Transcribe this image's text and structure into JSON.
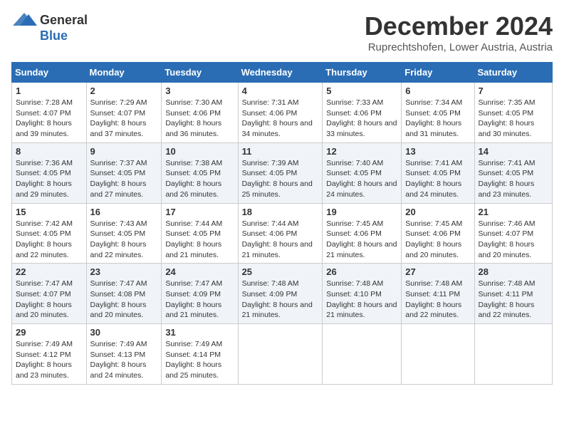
{
  "logo": {
    "general_text": "General",
    "blue_text": "Blue"
  },
  "header": {
    "month_year": "December 2024",
    "location": "Ruprechtshofen, Lower Austria, Austria"
  },
  "weekdays": [
    "Sunday",
    "Monday",
    "Tuesday",
    "Wednesday",
    "Thursday",
    "Friday",
    "Saturday"
  ],
  "weeks": [
    [
      {
        "day": "1",
        "sunrise": "7:28 AM",
        "sunset": "4:07 PM",
        "daylight": "8 hours and 39 minutes."
      },
      {
        "day": "2",
        "sunrise": "7:29 AM",
        "sunset": "4:07 PM",
        "daylight": "8 hours and 37 minutes."
      },
      {
        "day": "3",
        "sunrise": "7:30 AM",
        "sunset": "4:06 PM",
        "daylight": "8 hours and 36 minutes."
      },
      {
        "day": "4",
        "sunrise": "7:31 AM",
        "sunset": "4:06 PM",
        "daylight": "8 hours and 34 minutes."
      },
      {
        "day": "5",
        "sunrise": "7:33 AM",
        "sunset": "4:06 PM",
        "daylight": "8 hours and 33 minutes."
      },
      {
        "day": "6",
        "sunrise": "7:34 AM",
        "sunset": "4:05 PM",
        "daylight": "8 hours and 31 minutes."
      },
      {
        "day": "7",
        "sunrise": "7:35 AM",
        "sunset": "4:05 PM",
        "daylight": "8 hours and 30 minutes."
      }
    ],
    [
      {
        "day": "8",
        "sunrise": "7:36 AM",
        "sunset": "4:05 PM",
        "daylight": "8 hours and 29 minutes."
      },
      {
        "day": "9",
        "sunrise": "7:37 AM",
        "sunset": "4:05 PM",
        "daylight": "8 hours and 27 minutes."
      },
      {
        "day": "10",
        "sunrise": "7:38 AM",
        "sunset": "4:05 PM",
        "daylight": "8 hours and 26 minutes."
      },
      {
        "day": "11",
        "sunrise": "7:39 AM",
        "sunset": "4:05 PM",
        "daylight": "8 hours and 25 minutes."
      },
      {
        "day": "12",
        "sunrise": "7:40 AM",
        "sunset": "4:05 PM",
        "daylight": "8 hours and 24 minutes."
      },
      {
        "day": "13",
        "sunrise": "7:41 AM",
        "sunset": "4:05 PM",
        "daylight": "8 hours and 24 minutes."
      },
      {
        "day": "14",
        "sunrise": "7:41 AM",
        "sunset": "4:05 PM",
        "daylight": "8 hours and 23 minutes."
      }
    ],
    [
      {
        "day": "15",
        "sunrise": "7:42 AM",
        "sunset": "4:05 PM",
        "daylight": "8 hours and 22 minutes."
      },
      {
        "day": "16",
        "sunrise": "7:43 AM",
        "sunset": "4:05 PM",
        "daylight": "8 hours and 22 minutes."
      },
      {
        "day": "17",
        "sunrise": "7:44 AM",
        "sunset": "4:05 PM",
        "daylight": "8 hours and 21 minutes."
      },
      {
        "day": "18",
        "sunrise": "7:44 AM",
        "sunset": "4:06 PM",
        "daylight": "8 hours and 21 minutes."
      },
      {
        "day": "19",
        "sunrise": "7:45 AM",
        "sunset": "4:06 PM",
        "daylight": "8 hours and 21 minutes."
      },
      {
        "day": "20",
        "sunrise": "7:45 AM",
        "sunset": "4:06 PM",
        "daylight": "8 hours and 20 minutes."
      },
      {
        "day": "21",
        "sunrise": "7:46 AM",
        "sunset": "4:07 PM",
        "daylight": "8 hours and 20 minutes."
      }
    ],
    [
      {
        "day": "22",
        "sunrise": "7:47 AM",
        "sunset": "4:07 PM",
        "daylight": "8 hours and 20 minutes."
      },
      {
        "day": "23",
        "sunrise": "7:47 AM",
        "sunset": "4:08 PM",
        "daylight": "8 hours and 20 minutes."
      },
      {
        "day": "24",
        "sunrise": "7:47 AM",
        "sunset": "4:09 PM",
        "daylight": "8 hours and 21 minutes."
      },
      {
        "day": "25",
        "sunrise": "7:48 AM",
        "sunset": "4:09 PM",
        "daylight": "8 hours and 21 minutes."
      },
      {
        "day": "26",
        "sunrise": "7:48 AM",
        "sunset": "4:10 PM",
        "daylight": "8 hours and 21 minutes."
      },
      {
        "day": "27",
        "sunrise": "7:48 AM",
        "sunset": "4:11 PM",
        "daylight": "8 hours and 22 minutes."
      },
      {
        "day": "28",
        "sunrise": "7:48 AM",
        "sunset": "4:11 PM",
        "daylight": "8 hours and 22 minutes."
      }
    ],
    [
      {
        "day": "29",
        "sunrise": "7:49 AM",
        "sunset": "4:12 PM",
        "daylight": "8 hours and 23 minutes."
      },
      {
        "day": "30",
        "sunrise": "7:49 AM",
        "sunset": "4:13 PM",
        "daylight": "8 hours and 24 minutes."
      },
      {
        "day": "31",
        "sunrise": "7:49 AM",
        "sunset": "4:14 PM",
        "daylight": "8 hours and 25 minutes."
      },
      null,
      null,
      null,
      null
    ]
  ],
  "labels": {
    "sunrise": "Sunrise:",
    "sunset": "Sunset:",
    "daylight": "Daylight:"
  }
}
